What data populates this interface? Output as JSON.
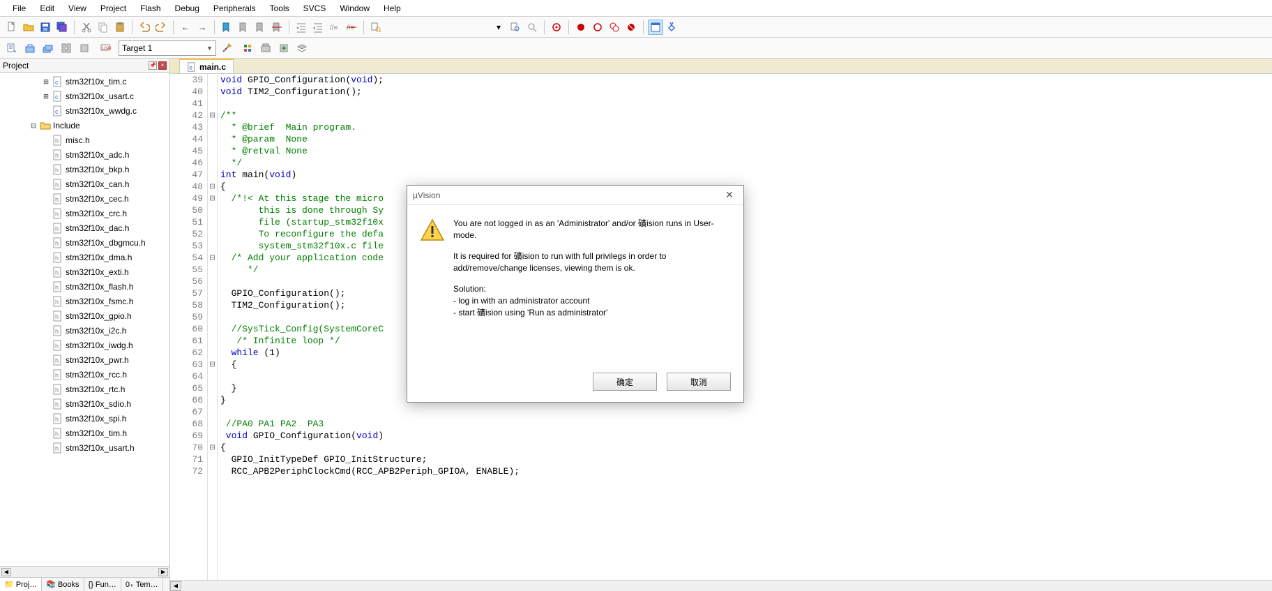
{
  "menu": [
    "File",
    "Edit",
    "View",
    "Project",
    "Flash",
    "Debug",
    "Peripherals",
    "Tools",
    "SVCS",
    "Window",
    "Help"
  ],
  "target": {
    "selected": "Target 1"
  },
  "project_panel": {
    "title": "Project",
    "tree": [
      {
        "indent": 2,
        "twisty": "+",
        "icon": "c-file",
        "label": "stm32f10x_tim.c"
      },
      {
        "indent": 2,
        "twisty": "+",
        "icon": "c-file",
        "label": "stm32f10x_usart.c"
      },
      {
        "indent": 2,
        "twisty": "",
        "icon": "c-file",
        "label": "stm32f10x_wwdg.c"
      },
      {
        "indent": 1,
        "twisty": "-",
        "icon": "folder",
        "label": "Include"
      },
      {
        "indent": 2,
        "twisty": "",
        "icon": "h-file",
        "label": "misc.h"
      },
      {
        "indent": 2,
        "twisty": "",
        "icon": "h-file",
        "label": "stm32f10x_adc.h"
      },
      {
        "indent": 2,
        "twisty": "",
        "icon": "h-file",
        "label": "stm32f10x_bkp.h"
      },
      {
        "indent": 2,
        "twisty": "",
        "icon": "h-file",
        "label": "stm32f10x_can.h"
      },
      {
        "indent": 2,
        "twisty": "",
        "icon": "h-file",
        "label": "stm32f10x_cec.h"
      },
      {
        "indent": 2,
        "twisty": "",
        "icon": "h-file",
        "label": "stm32f10x_crc.h"
      },
      {
        "indent": 2,
        "twisty": "",
        "icon": "h-file",
        "label": "stm32f10x_dac.h"
      },
      {
        "indent": 2,
        "twisty": "",
        "icon": "h-file",
        "label": "stm32f10x_dbgmcu.h"
      },
      {
        "indent": 2,
        "twisty": "",
        "icon": "h-file",
        "label": "stm32f10x_dma.h"
      },
      {
        "indent": 2,
        "twisty": "",
        "icon": "h-file",
        "label": "stm32f10x_exti.h"
      },
      {
        "indent": 2,
        "twisty": "",
        "icon": "h-file",
        "label": "stm32f10x_flash.h"
      },
      {
        "indent": 2,
        "twisty": "",
        "icon": "h-file",
        "label": "stm32f10x_fsmc.h"
      },
      {
        "indent": 2,
        "twisty": "",
        "icon": "h-file",
        "label": "stm32f10x_gpio.h"
      },
      {
        "indent": 2,
        "twisty": "",
        "icon": "h-file",
        "label": "stm32f10x_i2c.h"
      },
      {
        "indent": 2,
        "twisty": "",
        "icon": "h-file",
        "label": "stm32f10x_iwdg.h"
      },
      {
        "indent": 2,
        "twisty": "",
        "icon": "h-file",
        "label": "stm32f10x_pwr.h"
      },
      {
        "indent": 2,
        "twisty": "",
        "icon": "h-file",
        "label": "stm32f10x_rcc.h"
      },
      {
        "indent": 2,
        "twisty": "",
        "icon": "h-file",
        "label": "stm32f10x_rtc.h"
      },
      {
        "indent": 2,
        "twisty": "",
        "icon": "h-file",
        "label": "stm32f10x_sdio.h"
      },
      {
        "indent": 2,
        "twisty": "",
        "icon": "h-file",
        "label": "stm32f10x_spi.h"
      },
      {
        "indent": 2,
        "twisty": "",
        "icon": "h-file",
        "label": "stm32f10x_tim.h"
      },
      {
        "indent": 2,
        "twisty": "",
        "icon": "h-file",
        "label": "stm32f10x_usart.h"
      }
    ],
    "tabs": [
      {
        "icon": "proj",
        "label": "Proj…",
        "active": true
      },
      {
        "icon": "books",
        "label": "Books"
      },
      {
        "icon": "func",
        "label": "Fun…"
      },
      {
        "icon": "tmpl",
        "label": "Tem…"
      }
    ]
  },
  "editor": {
    "tab": "main.c",
    "first_line": 39,
    "fold": [
      "",
      "",
      "",
      "-",
      "",
      "",
      "",
      "",
      "",
      "-",
      "-",
      "",
      "",
      "",
      "",
      "-",
      "",
      "",
      "",
      "",
      "",
      "",
      "",
      "",
      "-",
      "",
      "",
      "",
      "",
      "",
      "",
      "-",
      "",
      ""
    ],
    "lines": [
      [
        [
          "kw",
          "void"
        ],
        [
          "",
          " GPIO_Configuration("
        ],
        [
          "kw",
          "void"
        ],
        [
          "",
          ");"
        ]
      ],
      [
        [
          "kw",
          "void"
        ],
        [
          "",
          " TIM2_Configuration();"
        ]
      ],
      [
        [
          "",
          ""
        ]
      ],
      [
        [
          "cm",
          "/**"
        ]
      ],
      [
        [
          "cm",
          "  * @brief  Main program."
        ]
      ],
      [
        [
          "cm",
          "  * @param  None"
        ]
      ],
      [
        [
          "cm",
          "  * @retval None"
        ]
      ],
      [
        [
          "cm",
          "  */"
        ]
      ],
      [
        [
          "kw",
          "int"
        ],
        [
          "",
          " main("
        ],
        [
          "kw",
          "void"
        ],
        [
          "",
          ")"
        ]
      ],
      [
        [
          "",
          "{"
        ]
      ],
      [
        [
          "cm",
          "  /*!< At this stage the micro"
        ]
      ],
      [
        [
          "cm",
          "       this is done through Sy"
        ]
      ],
      [
        [
          "cm",
          "       file (startup_stm32f10x"
        ]
      ],
      [
        [
          "cm",
          "       To reconfigure the defa"
        ]
      ],
      [
        [
          "cm",
          "       system_stm32f10x.c file"
        ]
      ],
      [
        [
          "cm",
          "  /* Add your application code"
        ]
      ],
      [
        [
          "cm",
          "     */"
        ]
      ],
      [
        [
          "",
          ""
        ]
      ],
      [
        [
          "",
          "  GPIO_Configuration();"
        ]
      ],
      [
        [
          "",
          "  TIM2_Configuration();"
        ]
      ],
      [
        [
          "",
          ""
        ]
      ],
      [
        [
          "cm",
          "  //SysTick_Config(SystemCoreC"
        ]
      ],
      [
        [
          "cm",
          "   /* Infinite loop */"
        ]
      ],
      [
        [
          "kw",
          "  while"
        ],
        [
          "",
          " (1)"
        ]
      ],
      [
        [
          "",
          "  {"
        ]
      ],
      [
        [
          "",
          ""
        ]
      ],
      [
        [
          "",
          "  }"
        ]
      ],
      [
        [
          "",
          "}"
        ]
      ],
      [
        [
          "",
          ""
        ]
      ],
      [
        [
          "cm",
          " //PA0 PA1 PA2  PA3"
        ]
      ],
      [
        [
          "kw",
          " void"
        ],
        [
          "",
          " GPIO_Configuration("
        ],
        [
          "kw",
          "void"
        ],
        [
          "",
          ")"
        ]
      ],
      [
        [
          "",
          "{"
        ]
      ],
      [
        [
          "",
          "  GPIO_InitTypeDef GPIO_InitStructure;"
        ]
      ],
      [
        [
          "",
          "  RCC_APB2PeriphClockCmd(RCC_APB2Periph_GPIOA, ENABLE);"
        ]
      ]
    ]
  },
  "dialog": {
    "title": "µVision",
    "p1": "You are not logged in as an 'Administrator' and/or 礦ision runs in User-mode.",
    "p2": "It is required for 礦ision to run with full privilegs in order to add/remove/change licenses, viewing them is ok.",
    "sol_h": "Solution:",
    "sol1": " - log in with an administrator account",
    "sol2": " - start 礦ision using 'Run as administrator'",
    "ok": "确定",
    "cancel": "取消"
  }
}
